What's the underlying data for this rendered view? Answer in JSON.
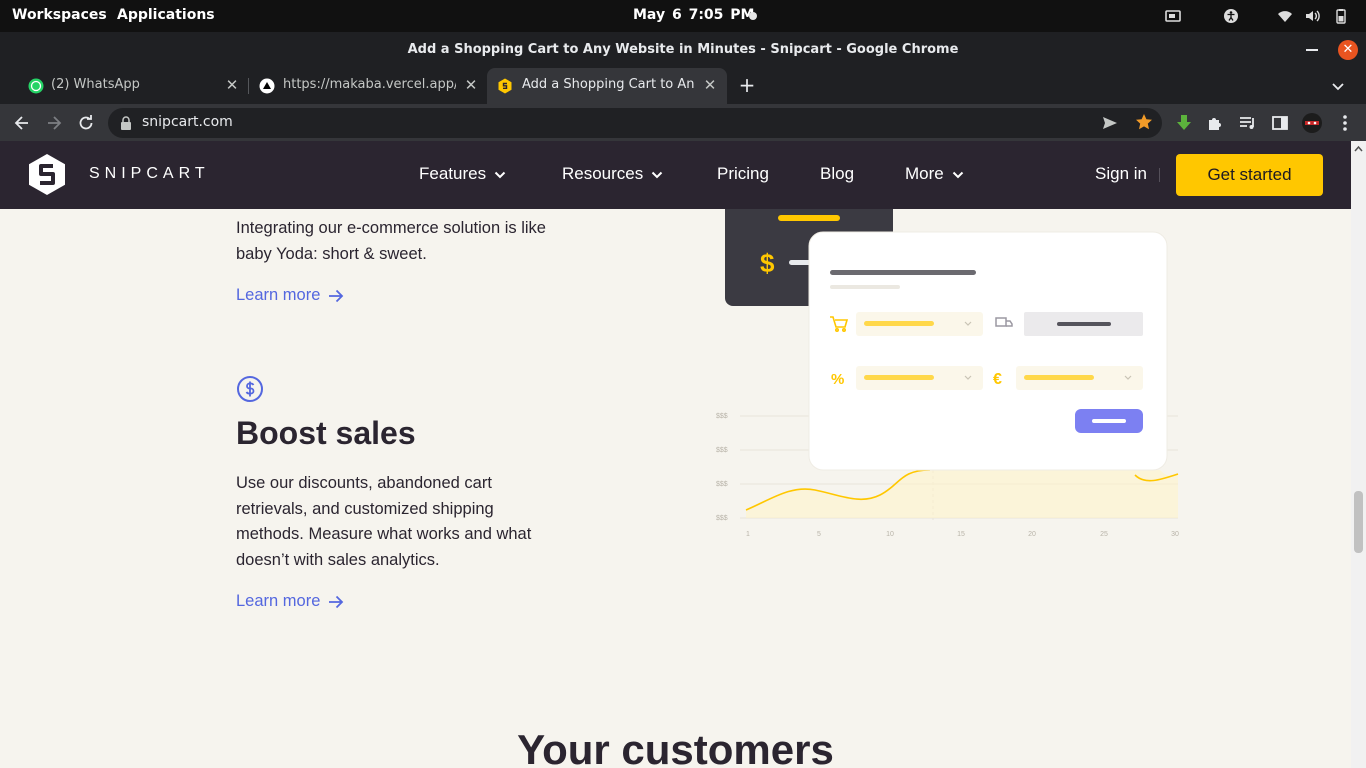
{
  "os_bar": {
    "workspaces": "Workspaces",
    "applications": "Applications",
    "date": "May 6",
    "time": "7:05 PM"
  },
  "window": {
    "title": "Add a Shopping Cart to Any Website in Minutes - Snipcart - Google Chrome"
  },
  "tabs": [
    {
      "label": "(2) WhatsApp",
      "favicon": "whatsapp-icon"
    },
    {
      "label": "https://makaba.vercel.app/st",
      "favicon": "vercel-icon"
    },
    {
      "label": "Add a Shopping Cart to Any W",
      "favicon": "snipcart-icon",
      "active": true
    }
  ],
  "toolbar": {
    "url": "snipcart.com"
  },
  "nav": {
    "logo_text": "SNIPCART",
    "items": [
      {
        "label": "Features",
        "has_dropdown": true
      },
      {
        "label": "Resources",
        "has_dropdown": true
      },
      {
        "label": "Pricing",
        "has_dropdown": false
      },
      {
        "label": "Blog",
        "has_dropdown": false
      },
      {
        "label": "More",
        "has_dropdown": true
      }
    ],
    "sign_in": "Sign in",
    "cta": "Get started"
  },
  "sections": {
    "integrate": {
      "body_line1": "Integrating our e-commerce solution is like",
      "body_line2": "baby Yoda: short & sweet.",
      "link": "Learn more"
    },
    "boost": {
      "icon": "dollar-circle-icon",
      "title": "Boost sales",
      "body_line1": "Use our discounts, abandoned cart",
      "body_line2": "retrievals, and customized shipping",
      "body_line3": "methods. Measure what works and what",
      "body_line4": "doesn’t with sales analytics.",
      "link": "Learn more"
    },
    "customers": {
      "title": "Your customers"
    }
  },
  "illustration": {
    "currency_symbol": "$",
    "euro_symbol": "€",
    "percent_symbol": "%",
    "y_ticks": [
      "$$$",
      "$$$",
      "$$$",
      "$$$"
    ],
    "x_ticks": [
      "1",
      "5",
      "10",
      "15",
      "20",
      "25",
      "30"
    ]
  },
  "colors": {
    "nav_bg": "#2b2530",
    "accent_yellow": "#ffc700",
    "link_blue": "#5467df",
    "page_bg": "#f6f4ee"
  }
}
